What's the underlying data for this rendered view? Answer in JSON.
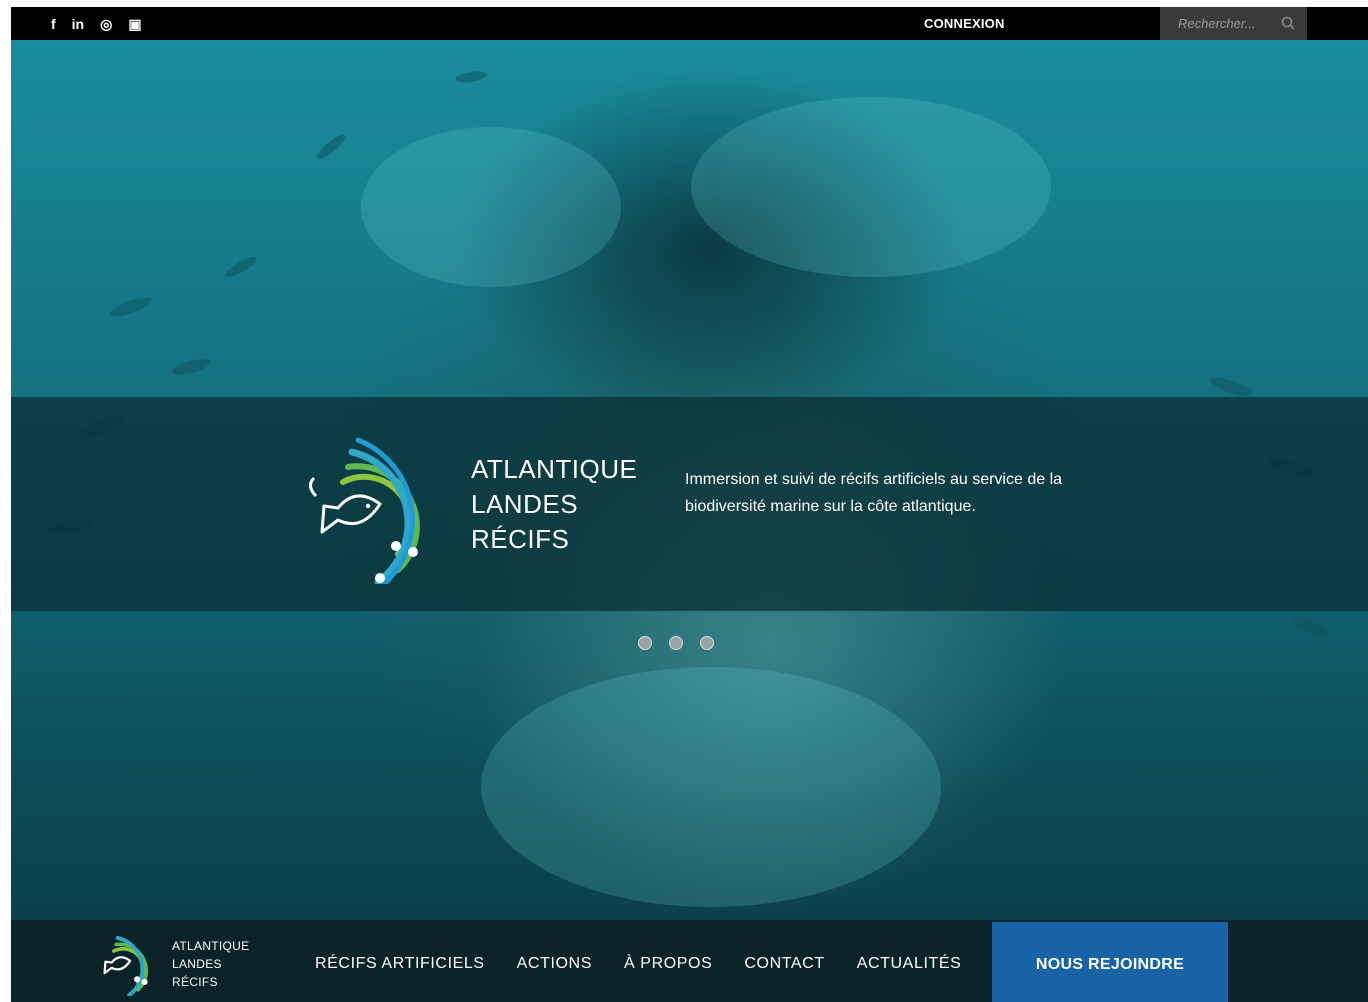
{
  "topbar": {
    "social": [
      {
        "icon": "facebook-icon",
        "glyph": "f"
      },
      {
        "icon": "linkedin-icon",
        "glyph": "in"
      },
      {
        "icon": "instagram-icon",
        "glyph": "◎"
      },
      {
        "icon": "youtube-icon",
        "glyph": "▣"
      }
    ],
    "login_label": "CONNEXION",
    "search": {
      "placeholder": "Rechercher..."
    }
  },
  "hero": {
    "brand": {
      "line1": "ATLANTIQUE",
      "line2": "LANDES",
      "line3": "RÉCIFS"
    },
    "tagline": "Immersion et suivi de récifs artificiels au service de la biodiversité marine sur la côte atlantique.",
    "slides_count": 3
  },
  "nav": {
    "brand": {
      "line1": "ATLANTIQUE",
      "line2": "LANDES",
      "line3": "RÉCIFS"
    },
    "links": [
      "RÉCIFS ARTIFICIELS",
      "ACTIONS",
      "À PROPOS",
      "CONTACT",
      "ACTUALITÉS"
    ],
    "cta": "NOUS REJOINDRE"
  },
  "colors": {
    "cta": "#1863a5",
    "logo_green": "#8cc63f",
    "logo_blue": "#1f9ad6",
    "topbar": "#000000"
  }
}
